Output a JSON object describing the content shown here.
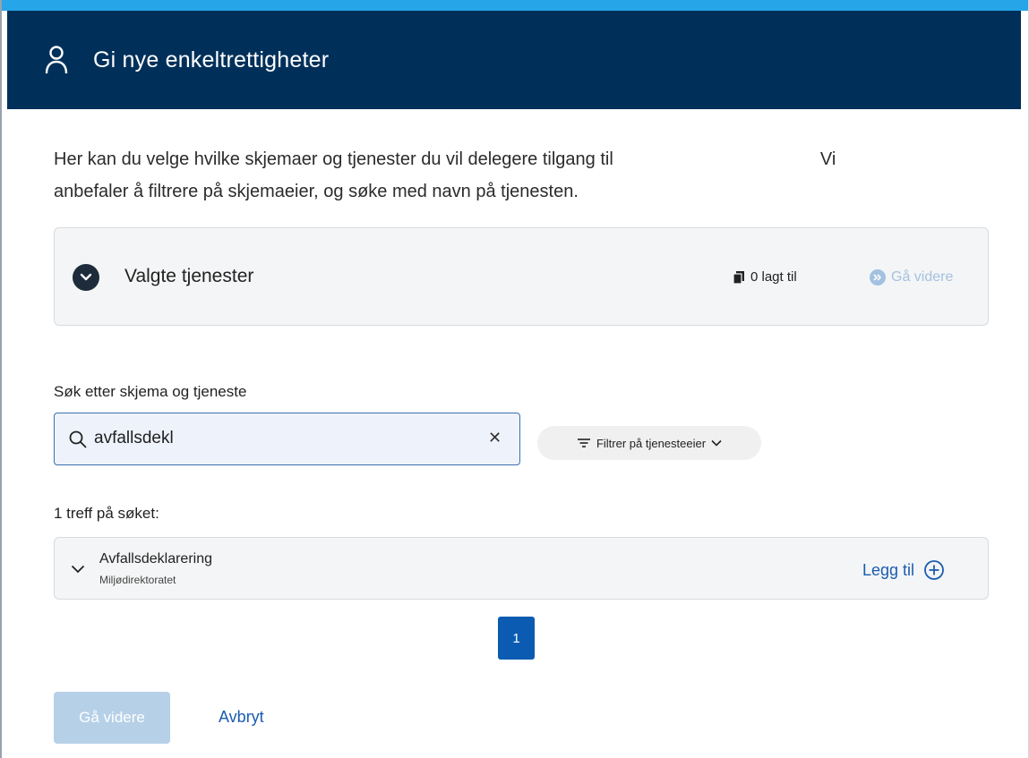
{
  "header": {
    "title": "Gi nye enkeltrettigheter",
    "icon": "person-icon"
  },
  "intro": {
    "line1_start": "Her kan du velge hvilke skjemaer og tjenester du vil delegere tilgang til",
    "line1_end": "Vi",
    "line2": "anbefaler å filtrere på skjemaeier, og søke med navn på tjenesten."
  },
  "selected_panel": {
    "title": "Valgte tjenester",
    "count_label": "0 lagt til",
    "proceed_label": "Gå videre"
  },
  "search": {
    "label": "Søk etter skjema og tjeneste",
    "value": "avfallsdekl",
    "clear_symbol": "✕"
  },
  "filter": {
    "label": "Filtrer på tjenesteeier"
  },
  "results": {
    "summary": "1 treff på søket:",
    "items": [
      {
        "name": "Avfallsdeklarering",
        "owner": "Miljødirektoratet",
        "action": "Legg til"
      }
    ]
  },
  "pagination": {
    "current": "1"
  },
  "footer": {
    "primary_label": "Gå videre",
    "cancel_label": "Avbryt"
  },
  "colors": {
    "header_bg": "#00305a",
    "accent_bar": "#26a5e8",
    "link_blue": "#1a5cb0",
    "page_active": "#0a5bb1",
    "disabled_button": "#b6d0e8"
  }
}
